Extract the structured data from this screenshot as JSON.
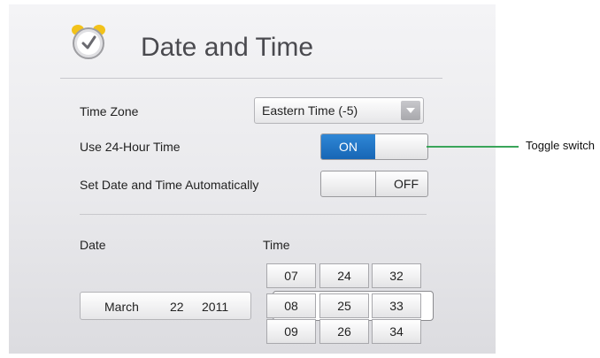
{
  "page": {
    "title": "Date and Time"
  },
  "settings": {
    "time_zone": {
      "label": "Time Zone",
      "value": "Eastern Time (-5)"
    },
    "use_24h": {
      "label": "Use 24-Hour Time",
      "on_label": "ON",
      "state": "on"
    },
    "auto_set": {
      "label": "Set Date and Time Automatically",
      "off_label": "OFF",
      "state": "off"
    }
  },
  "date": {
    "label": "Date",
    "month": "March",
    "day": "22",
    "year": "2011"
  },
  "time": {
    "label": "Time",
    "hours": [
      "07",
      "08",
      "09"
    ],
    "minutes": [
      "24",
      "25",
      "26"
    ],
    "seconds": [
      "32",
      "33",
      "34"
    ]
  },
  "annotation": {
    "text": "Toggle switch",
    "color": "#3aa55a"
  },
  "colors": {
    "accent": "#1f74c8",
    "title": "#4a4a4f"
  }
}
